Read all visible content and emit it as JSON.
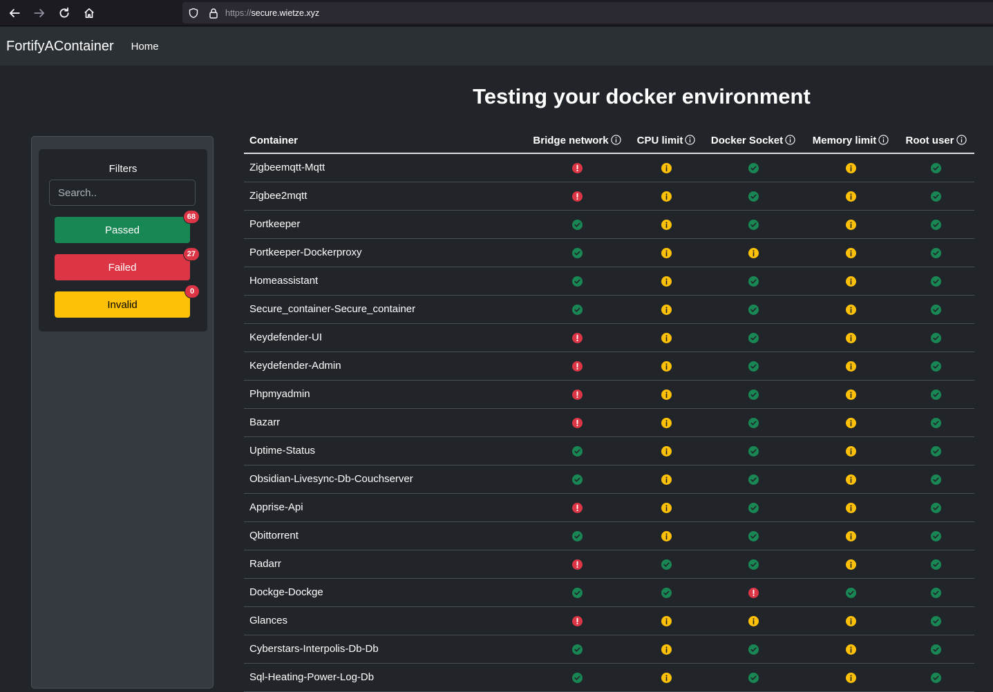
{
  "browser": {
    "url_protocol": "https://",
    "url_host": "secure.wietze.xyz"
  },
  "navbar": {
    "brand": "FortifyAContainer",
    "home_link": "Home"
  },
  "page_title": "Testing your docker environment",
  "filters": {
    "title": "Filters",
    "search_placeholder": "Search..",
    "passed_label": "Passed",
    "passed_count": "68",
    "failed_label": "Failed",
    "failed_count": "27",
    "invalid_label": "Invalid",
    "invalid_count": "0"
  },
  "colors": {
    "pass": "#198754",
    "fail": "#dc3545",
    "warn": "#ffc107"
  },
  "table": {
    "headers": {
      "container": "Container",
      "bridge": "Bridge network",
      "cpu": "CPU limit",
      "socket": "Docker Socket",
      "memory": "Memory limit",
      "root": "Root user"
    },
    "rows": [
      {
        "name": "Zigbeemqtt-Mqtt",
        "s": [
          "fail",
          "warn",
          "pass",
          "warn",
          "pass"
        ]
      },
      {
        "name": "Zigbee2mqtt",
        "s": [
          "fail",
          "warn",
          "pass",
          "warn",
          "pass"
        ]
      },
      {
        "name": "Portkeeper",
        "s": [
          "pass",
          "warn",
          "pass",
          "warn",
          "pass"
        ]
      },
      {
        "name": "Portkeeper-Dockerproxy",
        "s": [
          "pass",
          "warn",
          "warn",
          "warn",
          "pass"
        ]
      },
      {
        "name": "Homeassistant",
        "s": [
          "pass",
          "warn",
          "pass",
          "warn",
          "pass"
        ]
      },
      {
        "name": "Secure_container-Secure_container",
        "s": [
          "pass",
          "warn",
          "pass",
          "warn",
          "pass"
        ]
      },
      {
        "name": "Keydefender-UI",
        "s": [
          "fail",
          "warn",
          "pass",
          "warn",
          "pass"
        ]
      },
      {
        "name": "Keydefender-Admin",
        "s": [
          "fail",
          "warn",
          "pass",
          "warn",
          "pass"
        ]
      },
      {
        "name": "Phpmyadmin",
        "s": [
          "fail",
          "warn",
          "pass",
          "warn",
          "pass"
        ]
      },
      {
        "name": "Bazarr",
        "s": [
          "fail",
          "warn",
          "pass",
          "warn",
          "pass"
        ]
      },
      {
        "name": "Uptime-Status",
        "s": [
          "pass",
          "warn",
          "pass",
          "warn",
          "pass"
        ]
      },
      {
        "name": "Obsidian-Livesync-Db-Couchserver",
        "s": [
          "pass",
          "warn",
          "pass",
          "warn",
          "pass"
        ]
      },
      {
        "name": "Apprise-Api",
        "s": [
          "fail",
          "warn",
          "pass",
          "warn",
          "pass"
        ]
      },
      {
        "name": "Qbittorrent",
        "s": [
          "pass",
          "warn",
          "pass",
          "warn",
          "pass"
        ]
      },
      {
        "name": "Radarr",
        "s": [
          "fail",
          "pass",
          "pass",
          "warn",
          "pass"
        ]
      },
      {
        "name": "Dockge-Dockge",
        "s": [
          "pass",
          "pass",
          "fail",
          "pass",
          "pass"
        ]
      },
      {
        "name": "Glances",
        "s": [
          "fail",
          "warn",
          "warn",
          "warn",
          "pass"
        ]
      },
      {
        "name": "Cyberstars-Interpolis-Db-Db",
        "s": [
          "pass",
          "warn",
          "pass",
          "warn",
          "pass"
        ]
      },
      {
        "name": "Sql-Heating-Power-Log-Db",
        "s": [
          "pass",
          "warn",
          "pass",
          "warn",
          "pass"
        ]
      }
    ]
  }
}
